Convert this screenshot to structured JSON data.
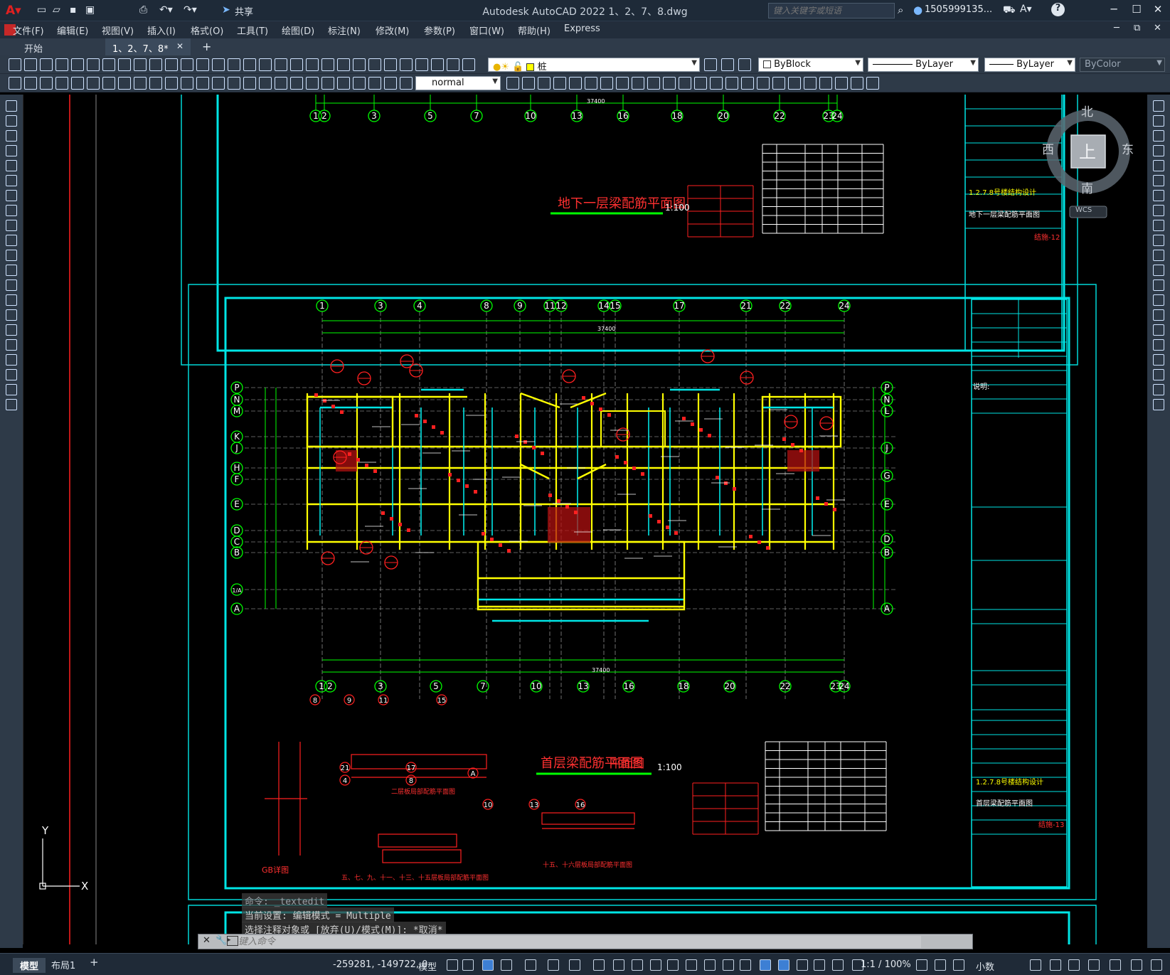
{
  "titlebar": {
    "app_title": "Autodesk AutoCAD 2022    1、2、7、8.dwg",
    "share_label": "共享",
    "search_placeholder": "键入关键字或短语",
    "user_name": "1505999135...",
    "minimize": "─",
    "maximize": "☐",
    "close": "✕"
  },
  "menu": {
    "items": [
      "文件(F)",
      "编辑(E)",
      "视图(V)",
      "插入(I)",
      "格式(O)",
      "工具(T)",
      "绘图(D)",
      "标注(N)",
      "修改(M)",
      "参数(P)",
      "窗口(W)",
      "帮助(H)",
      "Express"
    ]
  },
  "tabs": {
    "start": "开始",
    "active": "1、2、7、8*",
    "close": "✕",
    "add": "+"
  },
  "toolbar": {
    "layer_name": "桩",
    "color": "ByBlock",
    "linetype": "ByLayer",
    "lineweight": "ByLayer",
    "plotstyle": "ByColor",
    "text_style": "normal"
  },
  "viewcube": {
    "north": "北",
    "south": "南",
    "east": "东",
    "west": "西",
    "face": "上",
    "wcs": "WCS"
  },
  "drawing": {
    "plan1_title": "地下一层梁配筋平面图",
    "plan1_scale": "1:100",
    "plan2_title": "首层梁配筋平面图",
    "plan2_title_suffix": "平面图",
    "plan2_scale": "1:100",
    "project": "1.2.7.8号楼结构设计",
    "sheet1": "地下一层梁配筋平面图",
    "sheet1_no": "结施-12",
    "sheet2": "首层梁配筋平面图",
    "sheet2_no": "结施-13",
    "notes_title": "说明:",
    "dim_total": "37400",
    "top_axes1": [
      "1",
      "2",
      "3",
      "5",
      "7",
      "10",
      "13",
      "16",
      "18",
      "20",
      "22",
      "23",
      "24"
    ],
    "top_axes2": [
      "1",
      "3",
      "4",
      "8",
      "9",
      "11",
      "12",
      "14",
      "15",
      "17",
      "21",
      "22",
      "24"
    ],
    "left_axes": [
      "P",
      "N",
      "M",
      "K",
      "J",
      "H",
      "F",
      "E",
      "D",
      "C",
      "B",
      "1/A",
      "A"
    ],
    "right_axes": [
      "P",
      "N",
      "L",
      "J",
      "G",
      "E",
      "D",
      "B",
      "A"
    ],
    "bottom_axes2": [
      "1",
      "2",
      "3",
      "5",
      "7",
      "10",
      "13",
      "16",
      "18",
      "20",
      "22",
      "23",
      "24"
    ],
    "detail1_title": "二层板局部配筋平面图",
    "detail2_title": "五、七、九、十一、十三、十五层板局部配筋平面图",
    "detail3_title": "十五、十六层板局部配筋平面图",
    "detail4_title": "GB详图",
    "ucs_y": "Y",
    "ucs_x": "X"
  },
  "command": {
    "line1": "命令: _textedit",
    "line2": "当前设置: 编辑模式 = Multiple",
    "line3": "选择注释对象或 [放弃(U)/模式(M)]: *取消*",
    "placeholder": "键入命令"
  },
  "status": {
    "model_tab": "模型",
    "layout_tab": "布局1",
    "add": "+",
    "coords": "-259281, -149722, 0",
    "model_label": "模型",
    "scale": "1:1 / 100%",
    "units": "小数"
  },
  "colors": {
    "cyan": "#00e5e5",
    "green": "#00ff00",
    "yellow": "#ffff00",
    "red": "#ff2020",
    "white": "#ffffff"
  }
}
